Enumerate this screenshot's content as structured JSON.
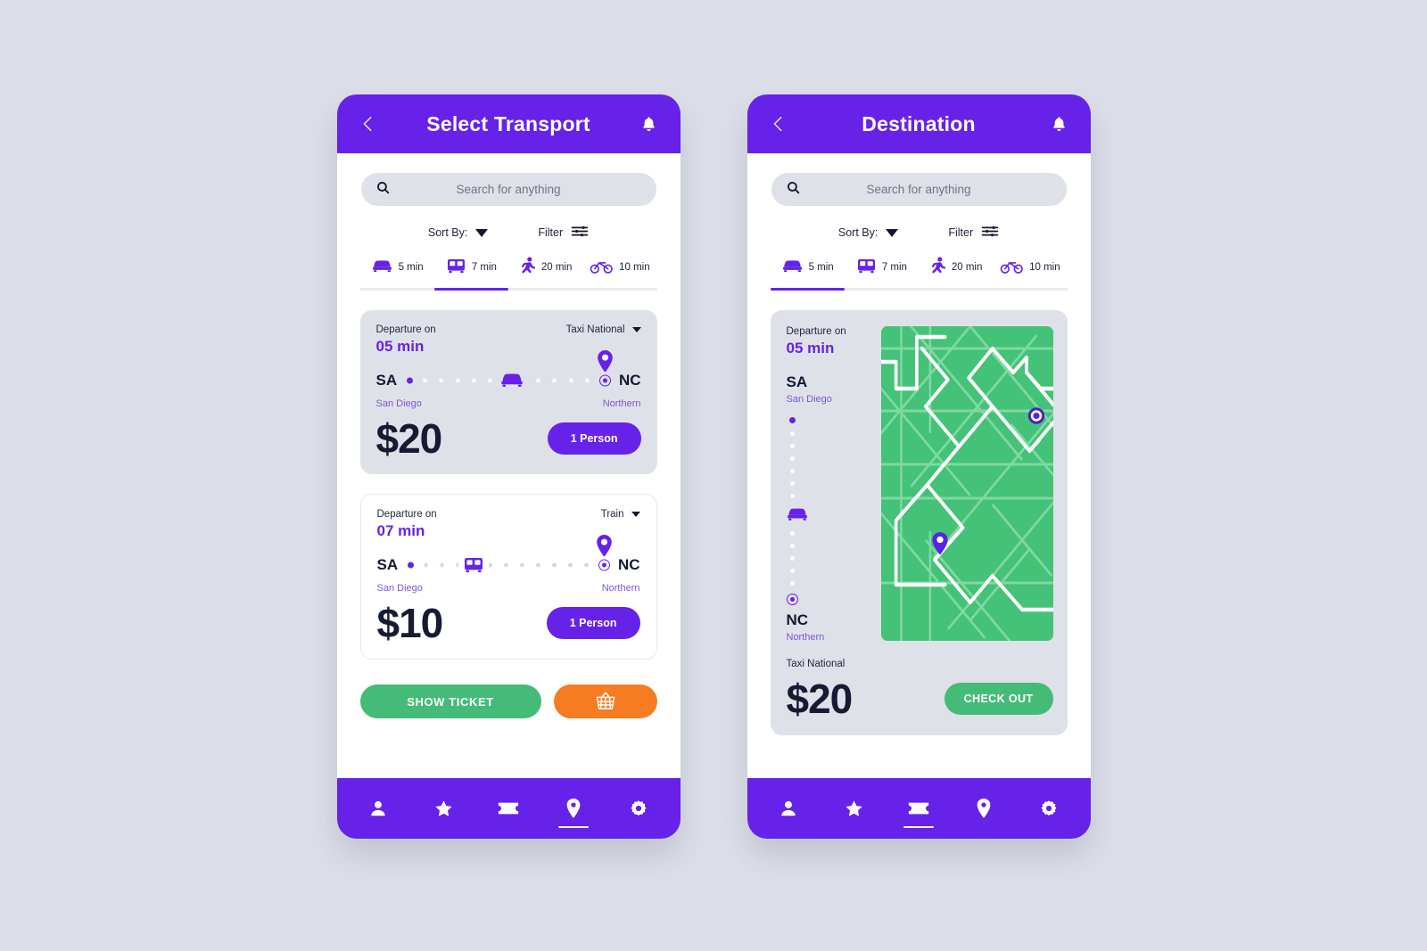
{
  "theme": {
    "purple": "#6622e8",
    "green": "#45bb78",
    "orange": "#f57c20",
    "map_green": "#44c278",
    "card_grey": "#dfe1e9",
    "page_bg": "#dcdfe8"
  },
  "screen1": {
    "header": {
      "title": "Select Transport",
      "back_icon": "chevron-left-icon",
      "bell_icon": "bell-icon"
    },
    "search": {
      "placeholder": "Search for anything",
      "value": "",
      "icon": "search-icon"
    },
    "controls": {
      "sort_label": "Sort By:",
      "filter_label": "Filter",
      "sort_icon": "caret-down-icon",
      "filter_icon": "sliders-icon"
    },
    "tabs": [
      {
        "mode": "car",
        "icon": "car-icon",
        "label": "5 min",
        "active": false
      },
      {
        "mode": "bus",
        "icon": "bus-icon",
        "label": "7 min",
        "active": true
      },
      {
        "mode": "walk",
        "icon": "walking-icon",
        "label": "20 min",
        "active": false
      },
      {
        "mode": "bike",
        "icon": "bicycle-icon",
        "label": "10 min",
        "active": false
      }
    ],
    "cards": [
      {
        "departure_label": "Departure on",
        "departure_time": "05 min",
        "mode_label": "Taxi National",
        "from_code": "SA",
        "from_name": "San Diego",
        "to_code": "NC",
        "to_name": "Northern",
        "route_icon": "car-icon",
        "price": "$20",
        "passengers": "1 Person",
        "style": "grey"
      },
      {
        "departure_label": "Departure on",
        "departure_time": "07 min",
        "mode_label": "Train",
        "from_code": "SA",
        "from_name": "San Diego",
        "to_code": "NC",
        "to_name": "Northern",
        "route_icon": "bus-icon",
        "price": "$10",
        "passengers": "1 Person",
        "style": "white"
      }
    ],
    "actions": {
      "show_ticket": "SHOW TICKET",
      "cart_icon": "basket-icon"
    },
    "nav": [
      {
        "icon": "user-icon",
        "active": false
      },
      {
        "icon": "star-icon",
        "active": false
      },
      {
        "icon": "ticket-icon",
        "active": false
      },
      {
        "icon": "map-pin-icon",
        "active": true
      },
      {
        "icon": "gear-icon",
        "active": false
      }
    ]
  },
  "screen2": {
    "header": {
      "title": "Destination",
      "back_icon": "chevron-left-icon",
      "bell_icon": "bell-icon"
    },
    "search": {
      "placeholder": "Search for anything",
      "value": "",
      "icon": "search-icon"
    },
    "controls": {
      "sort_label": "Sort By:",
      "filter_label": "Filter",
      "sort_icon": "caret-down-icon",
      "filter_icon": "sliders-icon"
    },
    "tabs": [
      {
        "mode": "car",
        "icon": "car-icon",
        "label": "5 min",
        "active": true
      },
      {
        "mode": "bus",
        "icon": "bus-icon",
        "label": "7 min",
        "active": false
      },
      {
        "mode": "walk",
        "icon": "walking-icon",
        "label": "20 min",
        "active": false
      },
      {
        "mode": "bike",
        "icon": "bicycle-icon",
        "label": "10 min",
        "active": false
      }
    ],
    "trip": {
      "departure_label": "Departure on",
      "departure_time": "05 min",
      "from_code": "SA",
      "from_name": "San Diego",
      "to_code": "NC",
      "to_name": "Northern",
      "route_icon": "car-icon",
      "mode_label": "Taxi National",
      "price": "$20",
      "checkout_label": "CHECK OUT",
      "map": {
        "origin_marker": "target-marker",
        "destination_marker": "map-pin-icon"
      }
    },
    "nav": [
      {
        "icon": "user-icon",
        "active": false
      },
      {
        "icon": "star-icon",
        "active": false
      },
      {
        "icon": "ticket-icon",
        "active": true
      },
      {
        "icon": "map-pin-icon",
        "active": false
      },
      {
        "icon": "gear-icon",
        "active": false
      }
    ]
  }
}
